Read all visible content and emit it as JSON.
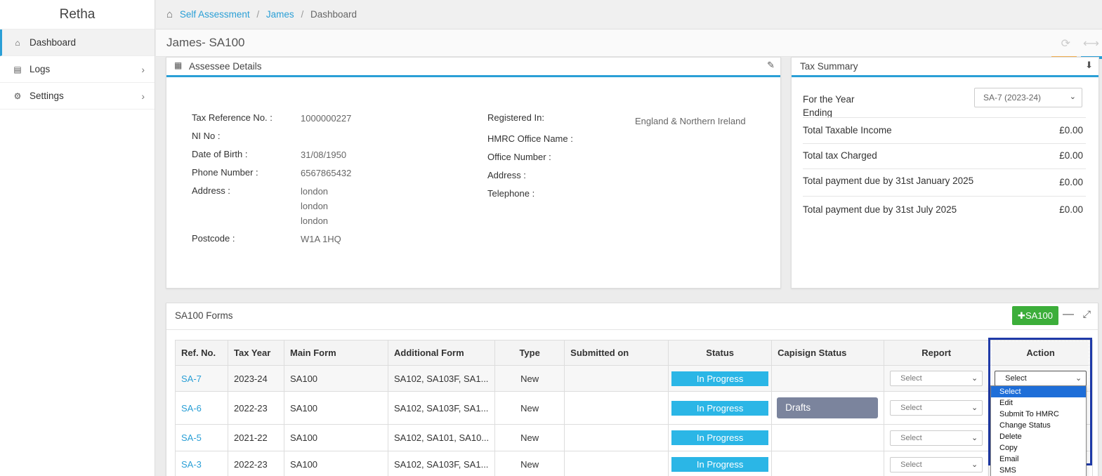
{
  "sidebar": {
    "brand": "Retha",
    "items": [
      {
        "label": "Dashboard",
        "icon": "home-icon"
      },
      {
        "label": "Logs",
        "icon": "file-icon"
      },
      {
        "label": "Settings",
        "icon": "gear-icon"
      }
    ]
  },
  "breadcrumb": {
    "items": [
      "Self Assessment",
      "James",
      "Dashboard"
    ]
  },
  "page": {
    "title": "James- SA100"
  },
  "assessee": {
    "title": "Assessee Details",
    "left": [
      {
        "label": "Tax Reference No. :",
        "value": "1000000227"
      },
      {
        "label": "NI No :",
        "value": ""
      },
      {
        "label": "Date of Birth :",
        "value": "31/08/1950"
      },
      {
        "label": "Phone Number :",
        "value": "6567865432"
      },
      {
        "label": "Address :",
        "value": "london",
        "value2": "london",
        "value3": "london"
      },
      {
        "label": "Postcode :",
        "value": "W1A 1HQ"
      }
    ],
    "right": [
      {
        "label": "Registered In:",
        "value": "England & Northern Ireland"
      },
      {
        "label": "HMRC Office Name :"
      },
      {
        "label": "Office Number :"
      },
      {
        "label": "Address :"
      },
      {
        "label": "Telephone :"
      }
    ]
  },
  "tax_summary": {
    "title": "Tax Summary",
    "year_label_1": "For the Year",
    "year_label_2": "Ending",
    "year_selected": "SA-7 (2023-24)",
    "rows": [
      {
        "label": "Total Taxable Income",
        "value": "£0.00"
      },
      {
        "label": "Total tax Charged",
        "value": "£0.00"
      },
      {
        "label": "Total payment due by 31st January 2025",
        "value": "£0.00"
      },
      {
        "label": "Total payment due by 31st July 2025",
        "value": "£0.00"
      }
    ]
  },
  "forms": {
    "title": "SA100 Forms",
    "add_label": "SA100",
    "columns": [
      "Ref. No.",
      "Tax Year",
      "Main Form",
      "Additional Form",
      "Type",
      "Submitted on",
      "Status",
      "Capisign Status",
      "Report",
      "Action"
    ],
    "rows": [
      {
        "ref": "SA-7",
        "year": "2023-24",
        "main": "SA100",
        "additional": "SA102, SA103F, SA1...",
        "type": "New",
        "submitted": "",
        "status": "In Progress",
        "capisign": "",
        "report": "Select",
        "action": "Select"
      },
      {
        "ref": "SA-6",
        "year": "2022-23",
        "main": "SA100",
        "additional": "SA102, SA103F, SA1...",
        "type": "New",
        "submitted": "",
        "status": "In Progress",
        "capisign": "Drafts",
        "report": "Select",
        "action": ""
      },
      {
        "ref": "SA-5",
        "year": "2021-22",
        "main": "SA100",
        "additional": "SA102, SA101, SA10...",
        "type": "New",
        "submitted": "",
        "status": "In Progress",
        "capisign": "",
        "report": "Select",
        "action": ""
      },
      {
        "ref": "SA-3",
        "year": "2022-23",
        "main": "SA100",
        "additional": "SA102, SA103F, SA1...",
        "type": "New",
        "submitted": "",
        "status": "In Progress",
        "capisign": "",
        "report": "Select",
        "action": ""
      }
    ]
  },
  "action_dropdown": {
    "options": [
      "Select",
      "Edit",
      "Submit To HMRC",
      "Change Status",
      "Delete",
      "Copy",
      "Email",
      "SMS"
    ],
    "selected": "Select"
  },
  "colors": {
    "accent": "#2a9fd6",
    "status_badge": "#2bb6e6",
    "drafts_badge": "#7b849d",
    "add_button": "#3cae3a",
    "highlight": "#1f3aa8"
  }
}
